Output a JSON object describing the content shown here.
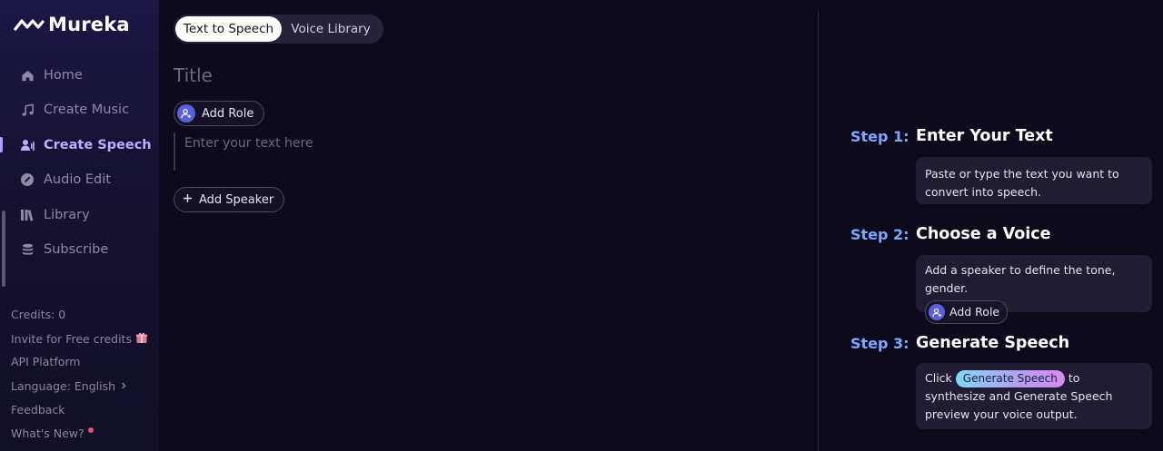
{
  "brand": {
    "name": "Mureka"
  },
  "sidebar": {
    "items": [
      {
        "label": "Home",
        "icon": "home-icon"
      },
      {
        "label": "Create Music",
        "icon": "music-note-icon"
      },
      {
        "label": "Create Speech",
        "icon": "speech-icon",
        "active": true
      },
      {
        "label": "Audio Edit",
        "icon": "edit-icon"
      },
      {
        "label": "Library",
        "icon": "library-icon"
      },
      {
        "label": "Subscribe",
        "icon": "stack-icon"
      }
    ],
    "bottom": {
      "credits": "Credits: 0",
      "invite": "Invite for Free credits",
      "api": "API Platform",
      "language": "Language: English",
      "feedback": "Feedback",
      "whats_new": "What's New?"
    }
  },
  "tabs": [
    "Text to Speech",
    "Voice Library"
  ],
  "editor": {
    "title_placeholder": "Title",
    "add_role": "Add Role",
    "text_placeholder": "Enter your text here",
    "add_speaker": "Add Speaker"
  },
  "steps": [
    {
      "label": "Step 1:",
      "title": "Enter Your Text",
      "body": "Paste or type the text you want to convert into speech."
    },
    {
      "label": "Step 2:",
      "title": "Choose a Voice",
      "body": "Add a speaker to define the tone, gender.",
      "button": "Add Role"
    },
    {
      "label": "Step 3:",
      "title": "Generate Speech",
      "body_pre": "Click",
      "chip": "Generate Speech",
      "body_post": "to synthesize and Generate Speech preview your voice output."
    }
  ],
  "colors": {
    "accent": "#b7b2ff",
    "step_label": "#7ea8ff",
    "background": "#0d0a1c"
  }
}
